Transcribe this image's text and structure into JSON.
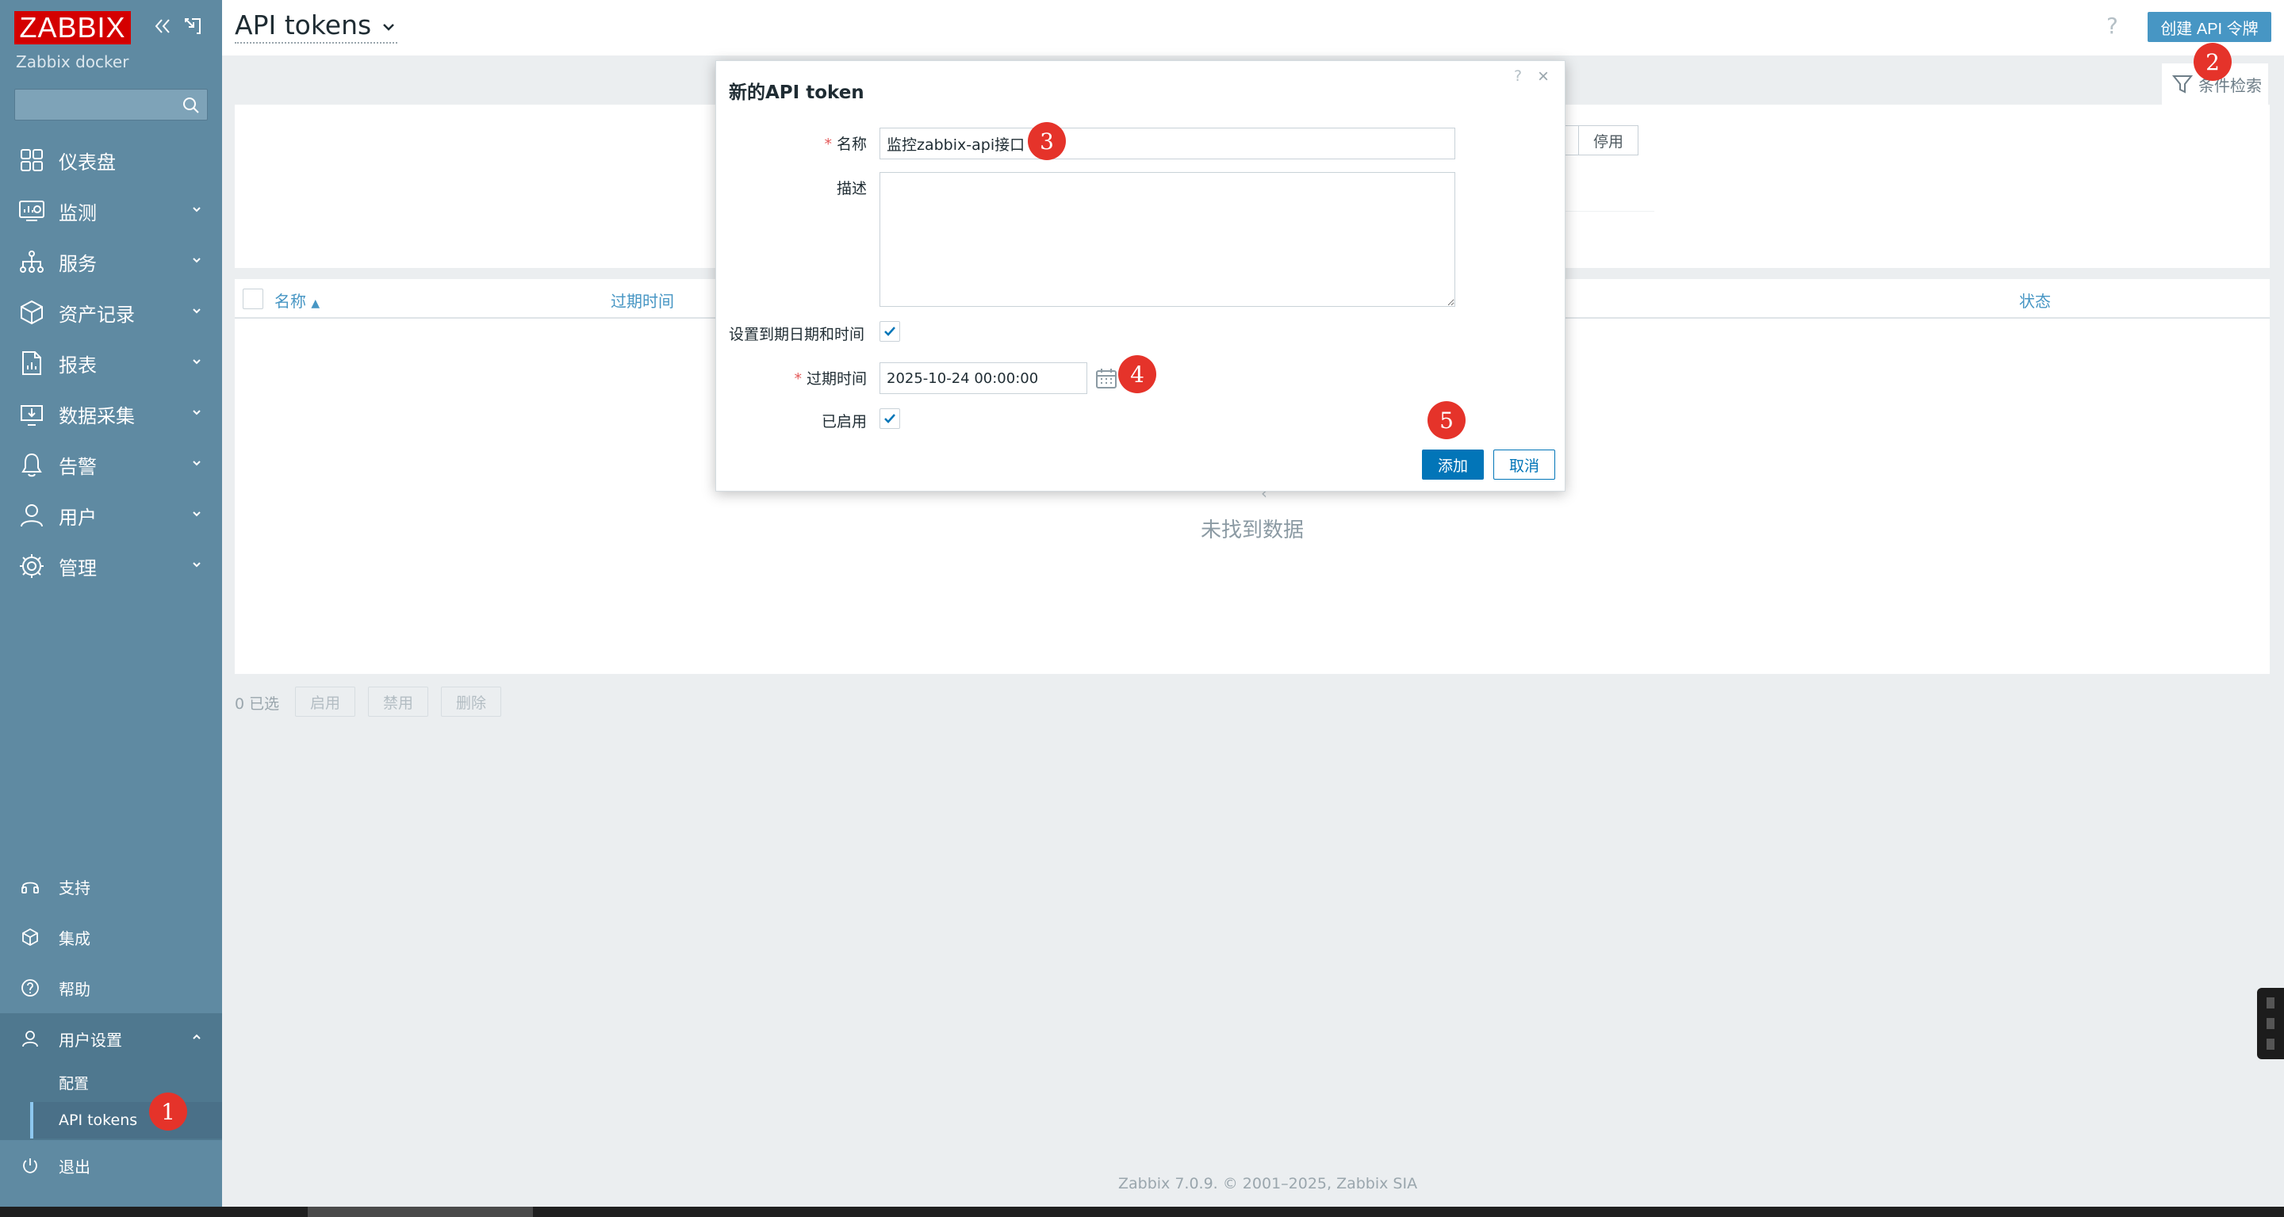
{
  "app": {
    "logo_text": "ZABBIX",
    "subtitle": "Zabbix docker",
    "colors": {
      "sidebar": "#5f8aa2",
      "brand_red": "#d40000",
      "primary": "#0275b8",
      "accent": "#4796c4",
      "marker": "#e5332a"
    }
  },
  "sidebar": {
    "collapse_icon": "double-chevron-left-icon",
    "kiosk_icon": "collapse-arrow-icon",
    "search_icon": "search-icon",
    "menu": [
      {
        "label": "仪表盘",
        "icon": "dashboard-icon"
      },
      {
        "label": "监测",
        "icon": "monitoring-icon"
      },
      {
        "label": "服务",
        "icon": "services-icon"
      },
      {
        "label": "资产记录",
        "icon": "inventory-icon"
      },
      {
        "label": "报表",
        "icon": "reports-icon"
      },
      {
        "label": "数据采集",
        "icon": "data-collection-icon"
      },
      {
        "label": "告警",
        "icon": "bell-icon"
      },
      {
        "label": "用户",
        "icon": "users-icon"
      },
      {
        "label": "管理",
        "icon": "gear-icon"
      }
    ],
    "bottom": [
      {
        "label": "支持",
        "icon": "headset-icon"
      },
      {
        "label": "集成",
        "icon": "integrations-icon"
      },
      {
        "label": "帮助",
        "icon": "help-icon"
      }
    ],
    "user_settings": {
      "label": "用户设置",
      "items": [
        {
          "label": "配置"
        },
        {
          "label": "API tokens",
          "active": true
        }
      ]
    },
    "signout": "退出"
  },
  "header": {
    "title": "API tokens",
    "help": "?",
    "create_button": "创建 API 令牌",
    "filter_tab": "条件检索"
  },
  "filter": {
    "status_disabled": "停用"
  },
  "table": {
    "columns": [
      "名称",
      "过期时间",
      "状态"
    ],
    "sort_indicator": "▲",
    "empty_text": "未找到数据",
    "selected_count": "0 已选",
    "actions": [
      "启用",
      "禁用",
      "删除"
    ]
  },
  "modal": {
    "title": "新的API token",
    "help": "?",
    "close": "×",
    "name_label": "名称",
    "name_value": "监控zabbix-api接口",
    "description_label": "描述",
    "description_value": "",
    "set_expiry_label": "设置到期日期和时间",
    "set_expiry_checked": true,
    "expires_label": "过期时间",
    "expires_value": "2025-10-24 00:00:00",
    "enabled_label": "已启用",
    "enabled_checked": true,
    "add_button": "添加",
    "cancel_button": "取消"
  },
  "markers": [
    "1",
    "2",
    "3",
    "4",
    "5"
  ],
  "footer": "Zabbix 7.0.9. © 2001–2025, Zabbix SIA"
}
